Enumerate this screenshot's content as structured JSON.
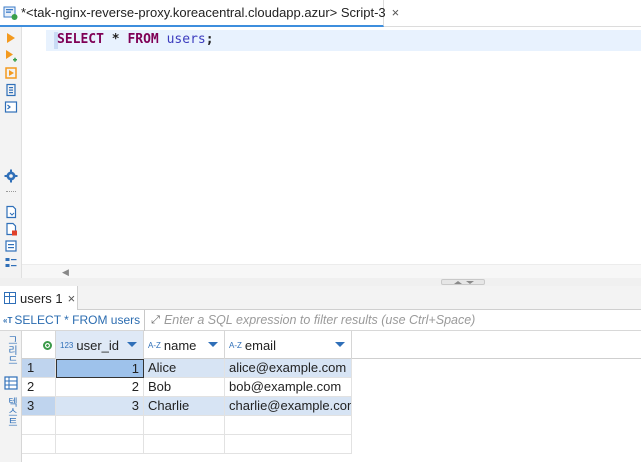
{
  "editor_tab": {
    "label": "*<tak-nginx-reverse-proxy.koreacentral.cloudapp.azur> Script-3",
    "close_glyph": "×",
    "icon": "sql-script-icon"
  },
  "editor": {
    "code_keyword1": "SELECT",
    "code_star": "*",
    "code_keyword2": "FROM",
    "code_table": "users",
    "code_semicolon": ";"
  },
  "editor_toolbar": {
    "icons": [
      "execute-statement-icon",
      "execute-in-new-tab-icon",
      "execute-script-icon",
      "explain-plan-icon",
      "console-icon",
      "settings-icon",
      "new-script-icon",
      "delete-script-icon",
      "export-icon",
      "format-icon"
    ]
  },
  "results_tab": {
    "label": "users 1",
    "close_glyph": "×"
  },
  "filter_bar": {
    "query_prefix": "«T",
    "query": "SELECT * FROM users",
    "placeholder": "Enter a SQL expression to filter results (use Ctrl+Space)"
  },
  "results_sidebar": {
    "grid_label": "그리드",
    "text_label": "텍스트"
  },
  "grid": {
    "columns": [
      {
        "name": "user_id",
        "type_badge": "123"
      },
      {
        "name": "name",
        "type_badge": "A-Z"
      },
      {
        "name": "email",
        "type_badge": "A-Z"
      }
    ],
    "rows": [
      {
        "num": "1",
        "user_id": "1",
        "name": "Alice",
        "email": "alice@example.com"
      },
      {
        "num": "2",
        "user_id": "2",
        "name": "Bob",
        "email": "bob@example.com"
      },
      {
        "num": "3",
        "user_id": "3",
        "name": "Charlie",
        "email": "charlie@example.com"
      }
    ]
  },
  "colors": {
    "accent": "#2f6fb8",
    "keyword": "#7f0055",
    "table_name": "#3c3cbe",
    "row_highlight": "#d7e4f4"
  }
}
